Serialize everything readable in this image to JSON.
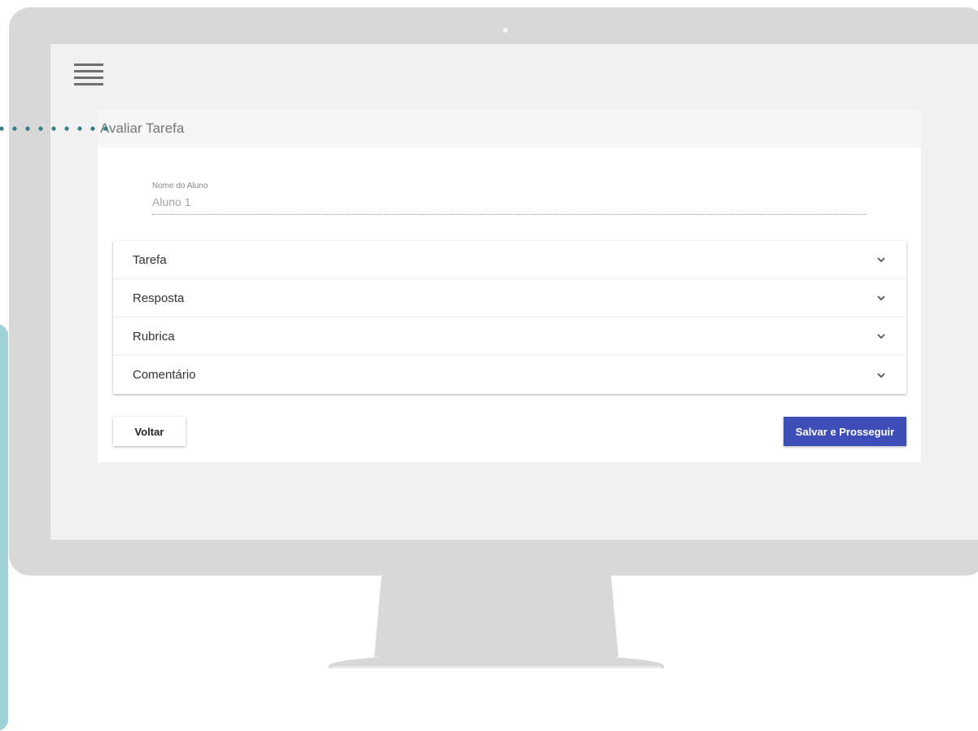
{
  "colors": {
    "primary": "#3d4eb8",
    "pointer": "#2e7f86",
    "side_panel": "#9fd3d8",
    "monitor": "#d8d8d8",
    "screen_bg": "#f1f1f1"
  },
  "header": {
    "menu_icon": "hamburger-menu-icon"
  },
  "page": {
    "title": "Avaliar Tarefa"
  },
  "student": {
    "label": "Nome do Aluno",
    "value": "Aluno 1"
  },
  "accordion": [
    {
      "label": "Tarefa",
      "icon": "chevron-down-icon"
    },
    {
      "label": "Resposta",
      "icon": "chevron-down-icon"
    },
    {
      "label": "Rubrica",
      "icon": "chevron-down-icon"
    },
    {
      "label": "Comentário",
      "icon": "chevron-down-icon"
    }
  ],
  "actions": {
    "back_label": "Voltar",
    "save_label": "Salvar e Prosseguir"
  }
}
